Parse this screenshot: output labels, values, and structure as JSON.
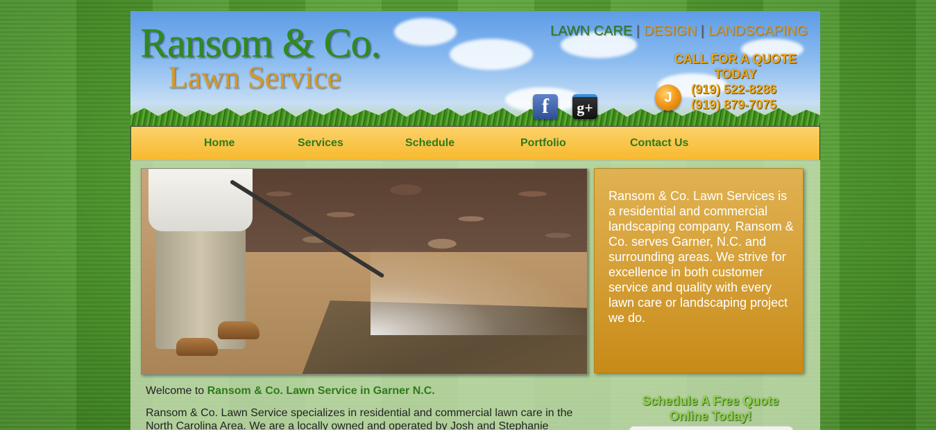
{
  "header": {
    "brand_name": "Ransom & Co.",
    "brand_sub": "Lawn Service",
    "tagline": {
      "part1": "LAWN CARE",
      "sep1": " | ",
      "part2": "DESIGN",
      "sep2": " | ",
      "part3": "LANDSCAPING"
    },
    "quote_line1": "CALL FOR A QUOTE",
    "quote_line2": "TODAY",
    "phone1": "(919) 522-8286",
    "phone2": "(919) 879-7075",
    "phone_icon_glyph": "J",
    "facebook_glyph": "f",
    "googleplus_glyph": "g+"
  },
  "nav": {
    "items": [
      {
        "label": "Home"
      },
      {
        "label": "Services"
      },
      {
        "label": "Schedule"
      },
      {
        "label": "Portfolio"
      },
      {
        "label": "Contact Us"
      }
    ]
  },
  "about": {
    "text": "Ransom & Co. Lawn Services is a residential and commercial landscaping company. Ransom & Co. serves Garner, N.C. and surrounding areas. We strive for excellence in both customer service and quality with every lawn care or landscaping project we do."
  },
  "welcome": {
    "prefix": "Welcome to ",
    "highlight": "Ransom & Co. Lawn Service in Garner N.C."
  },
  "intro": {
    "text": "Ransom & Co. Lawn Service specializes in residential and commercial lawn care in the North Carolina Area. We are a locally owned and operated by Josh and Stephanie"
  },
  "schedule_cta": {
    "line1": "Schedule A Free Quote",
    "line2": "Online Today!"
  },
  "colors": {
    "brand_green": "#2f8a1b",
    "brand_orange": "#d49a2a",
    "nav_bg": "#f7b92d",
    "about_bg": "#d5a038"
  },
  "icons": [
    "phone-icon",
    "facebook-icon",
    "google-plus-icon"
  ]
}
